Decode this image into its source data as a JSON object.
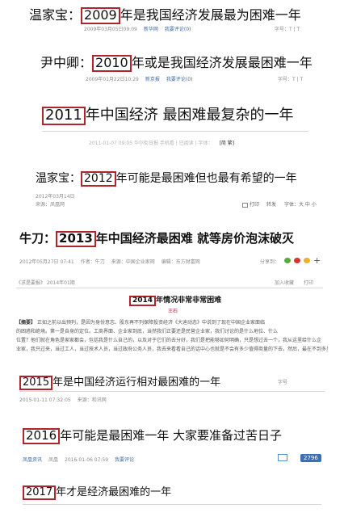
{
  "s1": {
    "prefix": "温家宝：",
    "year": "2009",
    "rest": "年是我国经济发展最为困难一年",
    "date": "2009年03月05日09:09",
    "source": "新华网",
    "comments": "我要评论(0)",
    "fontsize": "字号：T | T"
  },
  "s2": {
    "prefix": "尹中卿：",
    "year": "2010",
    "rest": "年或是我国经济发展最困难一年",
    "date": "2009年01月22日10:29",
    "source": "新京报",
    "comments": "我要评论(0)",
    "fontsize": "字号：T | T"
  },
  "s3": {
    "year": "2011",
    "rest": "年中国经济 最困难最复杂的一年",
    "meta_blur": "2011-01-07  09:05   华尔街日报  手机看 | 已阅读 | 字体：",
    "jianfan": "[简 繁]"
  },
  "s4": {
    "prefix": "温家宝：",
    "year": "2012",
    "rest": "年可能是最困难但也最有希望的一年",
    "date": "2012年03月14日",
    "source": "来源：凤凰网",
    "print": "打印",
    "share": "转发",
    "font": "字体：大 中 小"
  },
  "s5": {
    "prefix": "牛刀：",
    "year": "2013",
    "rest": "年中国经济最困难 就等房价泡沫破灭",
    "date": "2012年05月27日 07:41",
    "author": "作者：牛刀",
    "source": "来源：中国企业家网",
    "editor": "编辑：东方财富网",
    "share": "分享到："
  },
  "s6": {
    "crumb": "《求是要报》 2014年01期",
    "add_fav": "加入收藏",
    "print": "打印",
    "year": "2014",
    "rest": "年情况非常非常困难",
    "author": "王石",
    "abstract_label": "【摘要】",
    "lines": [
      "正如之前以出预判，是因为身份意志、股东再不列保障投资经济《大迪动态》中说到了现在中国企业家面临",
      "的困惑和绝境。第一是自身的定位。工商界面、企业家到底，当然我们正要还是民营企业家，我们讨论的是什么地位、什么",
      "位置？他们就在角色是家家都会，包括我是什么自己的，以及对于它们的去分好，我们是把能够如何明确，只是想过去一个，我从这里给什么企",
      "业家，我只过来，当过工人，当过技术人员，当过政府公务人员，我去来看看自己的话中心也就是不会有多少值得商量的下去，然后，最在不到多里，到来个深圳最"
    ]
  },
  "s7": {
    "year": "2015",
    "rest": "年是中国经济运行相对最困难的一年",
    "fontsize": "字号",
    "date": "2015-01-11 07:32:05",
    "source": "来源：和讯网"
  },
  "s8": {
    "year": "2016",
    "rest": "年可能是最困难一年 大家要准备过苦日子",
    "source": "凤凰资讯",
    "site": "凤凰",
    "date": "2016-01-06 07:59",
    "comments": "我要评论",
    "count": "2796"
  },
  "s9": {
    "year": "2017",
    "rest": "年才是经济最困难的一年"
  },
  "colors": {
    "highlight_box": "#b0242a",
    "link": "#3a6aa8"
  }
}
